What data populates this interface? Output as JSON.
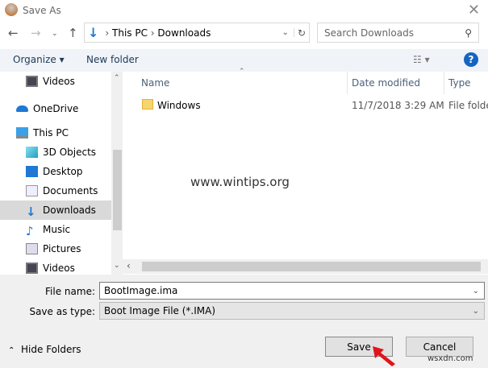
{
  "window": {
    "title": "Save As"
  },
  "address": {
    "segments": [
      "This PC",
      "Downloads"
    ]
  },
  "search": {
    "placeholder": "Search Downloads"
  },
  "toolbar": {
    "organize": "Organize",
    "new_folder": "New folder"
  },
  "nav": {
    "items": [
      {
        "label": "Videos",
        "icon": "videos-icon"
      },
      {
        "label": "OneDrive",
        "icon": "onedrive-icon"
      },
      {
        "label": "This PC",
        "icon": "pc-icon"
      },
      {
        "label": "3D Objects",
        "icon": "3d-objects-icon"
      },
      {
        "label": "Desktop",
        "icon": "desktop-icon"
      },
      {
        "label": "Documents",
        "icon": "documents-icon"
      },
      {
        "label": "Downloads",
        "icon": "downloads-icon",
        "selected": true
      },
      {
        "label": "Music",
        "icon": "music-icon"
      },
      {
        "label": "Pictures",
        "icon": "pictures-icon"
      },
      {
        "label": "Videos",
        "icon": "videos-icon"
      }
    ]
  },
  "columns": {
    "name": "Name",
    "date": "Date modified",
    "type": "Type"
  },
  "files": [
    {
      "name": "Windows",
      "date": "11/7/2018 3:29 AM",
      "type": "File folde"
    }
  ],
  "form": {
    "file_name_label": "File name:",
    "file_name": "BootImage.ima",
    "type_label": "Save as type:",
    "type": "Boot Image File (*.IMA)"
  },
  "buttons": {
    "hide_folders": "Hide Folders",
    "save": "Save",
    "cancel": "Cancel"
  },
  "watermarks": [
    "www.wintips.org",
    "wsxdn.com"
  ],
  "colors": {
    "accent": "#1e78d4",
    "selected": "#d9d9d9",
    "arrow": "#e0141b"
  }
}
